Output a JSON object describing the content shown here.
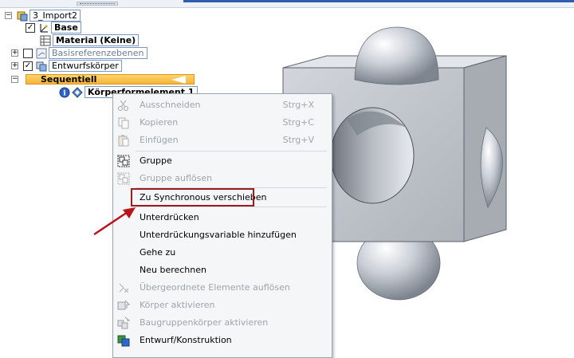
{
  "tree": {
    "root": "3_Import2",
    "base": "Base",
    "material": "Material (Keine)",
    "refplanes": "Basisreferenzebenen",
    "design_bodies": "Entwurfskörper",
    "sequential": "Sequentiell",
    "feature": "Körperformelement 1"
  },
  "menu": {
    "items": [
      {
        "label": "Ausschneiden",
        "shortcut": "Strg+X",
        "icon": "scissors-icon",
        "enabled": false
      },
      {
        "label": "Kopieren",
        "shortcut": "Strg+C",
        "icon": "copy-icon",
        "enabled": false
      },
      {
        "label": "Einfügen",
        "shortcut": "Strg+V",
        "icon": "paste-icon",
        "enabled": false
      },
      {
        "label": "Gruppe",
        "shortcut": "",
        "icon": "group-icon",
        "enabled": true
      },
      {
        "label": "Gruppe auflösen",
        "shortcut": "",
        "icon": "ungroup-icon",
        "enabled": false
      },
      {
        "label": "Zu Synchronous verschieben",
        "shortcut": "",
        "icon": "",
        "enabled": true
      },
      {
        "label": "Unterdrücken",
        "shortcut": "",
        "icon": "",
        "enabled": true
      },
      {
        "label": "Unterdrückungsvariable hinzufügen",
        "shortcut": "",
        "icon": "",
        "enabled": true
      },
      {
        "label": "Gehe zu",
        "shortcut": "",
        "icon": "",
        "enabled": true
      },
      {
        "label": "Neu berechnen",
        "shortcut": "",
        "icon": "",
        "enabled": true
      },
      {
        "label": "Übergeordnete Elemente auflösen",
        "shortcut": "",
        "icon": "dissolve-parents-icon",
        "enabled": false
      },
      {
        "label": "Körper aktivieren",
        "shortcut": "",
        "icon": "activate-body-icon",
        "enabled": false
      },
      {
        "label": "Baugruppenkörper aktivieren",
        "shortcut": "",
        "icon": "activate-assembly-body-icon",
        "enabled": false
      },
      {
        "label": "Entwurf/Konstruktion",
        "shortcut": "",
        "icon": "design-construction-icon",
        "enabled": true
      }
    ]
  },
  "colors": {
    "highlight_border": "#9b1b1f",
    "arrow": "#b5161c",
    "sequential_bg": "#f6b43a"
  }
}
